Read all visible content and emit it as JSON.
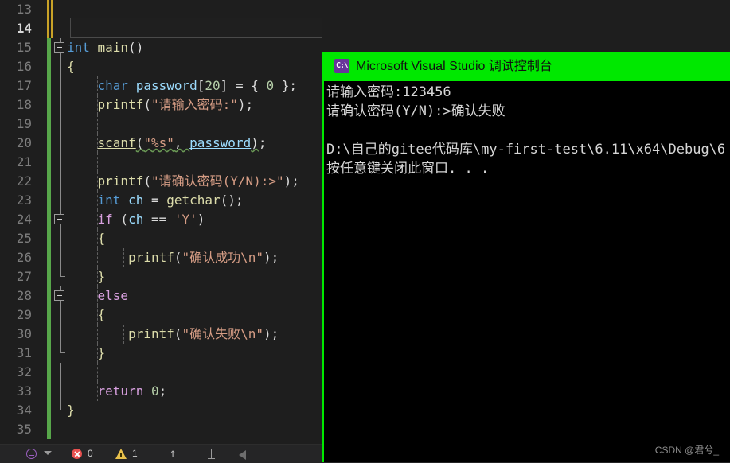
{
  "editor": {
    "name": "visual-studio-code-editor",
    "theme_colors": {
      "background": "#1e1e1e",
      "line_number": "#7d7d7d",
      "keyword": "#569cd6",
      "control_keyword": "#d8a0df",
      "variable": "#9cdcfe",
      "function": "#dcdcaa",
      "string": "#d69d85",
      "number": "#b5cea8",
      "change_bar_saved": "#57a64a",
      "change_bar_unsaved": "#c9a227"
    },
    "first_line": 13,
    "lines": [
      {
        "num": "13",
        "marker": "yellow",
        "fold": "",
        "guides": [],
        "tokens": []
      },
      {
        "num": "14",
        "marker": "yellow",
        "fold": "",
        "guides": [],
        "current": true,
        "tokens": []
      },
      {
        "num": "15",
        "marker": "green",
        "fold": "box-start",
        "guides": [],
        "tokens": [
          {
            "t": "int ",
            "c": "kw"
          },
          {
            "t": "main",
            "c": "fn"
          },
          {
            "t": "()",
            "c": "pun"
          }
        ]
      },
      {
        "num": "16",
        "marker": "green",
        "fold": "line",
        "guides": [],
        "tokens": [
          {
            "t": "{",
            "c": "brace"
          }
        ]
      },
      {
        "num": "17",
        "marker": "green",
        "fold": "line",
        "guides": [
          "g2"
        ],
        "tokens": [
          {
            "t": "    ",
            "c": "pun"
          },
          {
            "t": "char",
            "c": "kw"
          },
          {
            "t": " ",
            "c": "pun"
          },
          {
            "t": "password",
            "c": "var"
          },
          {
            "t": "[",
            "c": "pun"
          },
          {
            "t": "20",
            "c": "num"
          },
          {
            "t": "] = { ",
            "c": "pun"
          },
          {
            "t": "0",
            "c": "num"
          },
          {
            "t": " };",
            "c": "pun"
          }
        ]
      },
      {
        "num": "18",
        "marker": "green",
        "fold": "line",
        "guides": [
          "g2"
        ],
        "tokens": [
          {
            "t": "    ",
            "c": "pun"
          },
          {
            "t": "printf",
            "c": "fn"
          },
          {
            "t": "(",
            "c": "pun"
          },
          {
            "t": "\"请输入密码:\"",
            "c": "str"
          },
          {
            "t": ");",
            "c": "pun"
          }
        ]
      },
      {
        "num": "19",
        "marker": "green",
        "fold": "line",
        "guides": [
          "g2"
        ],
        "tokens": []
      },
      {
        "num": "20",
        "marker": "green",
        "fold": "line",
        "guides": [
          "g2"
        ],
        "tokens": [
          {
            "t": "    ",
            "c": "pun"
          },
          {
            "t": "scanf",
            "c": "fn sq ul"
          },
          {
            "t": "(",
            "c": "pun sq"
          },
          {
            "t": "\"%s\"",
            "c": "str sq"
          },
          {
            "t": ", ",
            "c": "pun sq"
          },
          {
            "t": "password",
            "c": "var sq ul"
          },
          {
            "t": ")",
            "c": "pun sq"
          },
          {
            "t": ";",
            "c": "pun"
          }
        ]
      },
      {
        "num": "21",
        "marker": "green",
        "fold": "line",
        "guides": [
          "g2"
        ],
        "tokens": []
      },
      {
        "num": "22",
        "marker": "green",
        "fold": "line",
        "guides": [
          "g2"
        ],
        "tokens": [
          {
            "t": "    ",
            "c": "pun"
          },
          {
            "t": "printf",
            "c": "fn"
          },
          {
            "t": "(",
            "c": "pun"
          },
          {
            "t": "\"请确认密码(Y/N):>\"",
            "c": "str"
          },
          {
            "t": ");",
            "c": "pun"
          }
        ]
      },
      {
        "num": "23",
        "marker": "green",
        "fold": "line",
        "guides": [
          "g2"
        ],
        "tokens": [
          {
            "t": "    ",
            "c": "pun"
          },
          {
            "t": "int",
            "c": "kw"
          },
          {
            "t": " ",
            "c": "pun"
          },
          {
            "t": "ch",
            "c": "var"
          },
          {
            "t": " = ",
            "c": "pun"
          },
          {
            "t": "getchar",
            "c": "fn"
          },
          {
            "t": "();",
            "c": "pun"
          }
        ]
      },
      {
        "num": "24",
        "marker": "green",
        "fold": "box-mid",
        "guides": [
          "g2"
        ],
        "tokens": [
          {
            "t": "    ",
            "c": "pun"
          },
          {
            "t": "if",
            "c": "kwctl"
          },
          {
            "t": " (",
            "c": "pun"
          },
          {
            "t": "ch",
            "c": "var"
          },
          {
            "t": " == ",
            "c": "pun"
          },
          {
            "t": "'Y'",
            "c": "str"
          },
          {
            "t": ")",
            "c": "pun"
          }
        ]
      },
      {
        "num": "25",
        "marker": "green",
        "fold": "line",
        "guides": [
          "g2"
        ],
        "tokens": [
          {
            "t": "    ",
            "c": "pun"
          },
          {
            "t": "{",
            "c": "brace"
          }
        ]
      },
      {
        "num": "26",
        "marker": "green",
        "fold": "line",
        "guides": [
          "g2",
          "g3"
        ],
        "tokens": [
          {
            "t": "        ",
            "c": "pun"
          },
          {
            "t": "printf",
            "c": "fn"
          },
          {
            "t": "(",
            "c": "pun"
          },
          {
            "t": "\"确认成功\\n\"",
            "c": "str"
          },
          {
            "t": ");",
            "c": "pun"
          }
        ]
      },
      {
        "num": "27",
        "marker": "green",
        "fold": "line-end",
        "guides": [
          "g2"
        ],
        "tokens": [
          {
            "t": "    ",
            "c": "pun"
          },
          {
            "t": "}",
            "c": "brace"
          }
        ]
      },
      {
        "num": "28",
        "marker": "green",
        "fold": "box-mid",
        "guides": [
          "g2"
        ],
        "tokens": [
          {
            "t": "    ",
            "c": "pun"
          },
          {
            "t": "else",
            "c": "kwctl"
          }
        ]
      },
      {
        "num": "29",
        "marker": "green",
        "fold": "line",
        "guides": [
          "g2"
        ],
        "tokens": [
          {
            "t": "    ",
            "c": "pun"
          },
          {
            "t": "{",
            "c": "brace"
          }
        ]
      },
      {
        "num": "30",
        "marker": "green",
        "fold": "line",
        "guides": [
          "g2",
          "g3"
        ],
        "tokens": [
          {
            "t": "        ",
            "c": "pun"
          },
          {
            "t": "printf",
            "c": "fn"
          },
          {
            "t": "(",
            "c": "pun"
          },
          {
            "t": "\"确认失败\\n\"",
            "c": "str"
          },
          {
            "t": ");",
            "c": "pun"
          }
        ]
      },
      {
        "num": "31",
        "marker": "green",
        "fold": "line-end",
        "guides": [
          "g2"
        ],
        "tokens": [
          {
            "t": "    ",
            "c": "pun"
          },
          {
            "t": "}",
            "c": "brace"
          }
        ]
      },
      {
        "num": "32",
        "marker": "green",
        "fold": "line",
        "guides": [
          "g2"
        ],
        "tokens": []
      },
      {
        "num": "33",
        "marker": "green",
        "fold": "line",
        "guides": [
          "g2"
        ],
        "tokens": [
          {
            "t": "    ",
            "c": "pun"
          },
          {
            "t": "return",
            "c": "kwctl"
          },
          {
            "t": " ",
            "c": "pun"
          },
          {
            "t": "0",
            "c": "num"
          },
          {
            "t": ";",
            "c": "pun"
          }
        ]
      },
      {
        "num": "34",
        "marker": "green",
        "fold": "line-end",
        "guides": [],
        "tokens": [
          {
            "t": "}",
            "c": "brace"
          }
        ]
      },
      {
        "num": "35",
        "marker": "green",
        "fold": "",
        "guides": [],
        "tokens": []
      }
    ]
  },
  "statusbar": {
    "name": "visual-studio-status-bar",
    "error_count": "0",
    "warning_count": "1"
  },
  "console": {
    "name": "debug-console-window",
    "title": "Microsoft Visual Studio 调试控制台",
    "icon_label": "C:\\",
    "title_bar_color": "#00e800",
    "background": "#000000",
    "lines": [
      "请输入密码:123456",
      "请确认密码(Y/N):>确认失败",
      "",
      "D:\\自己的gitee代码库\\my-first-test\\6.11\\x64\\Debug\\6",
      "按任意键关闭此窗口. . ."
    ]
  },
  "watermark": {
    "text": "CSDN @君兮_"
  }
}
